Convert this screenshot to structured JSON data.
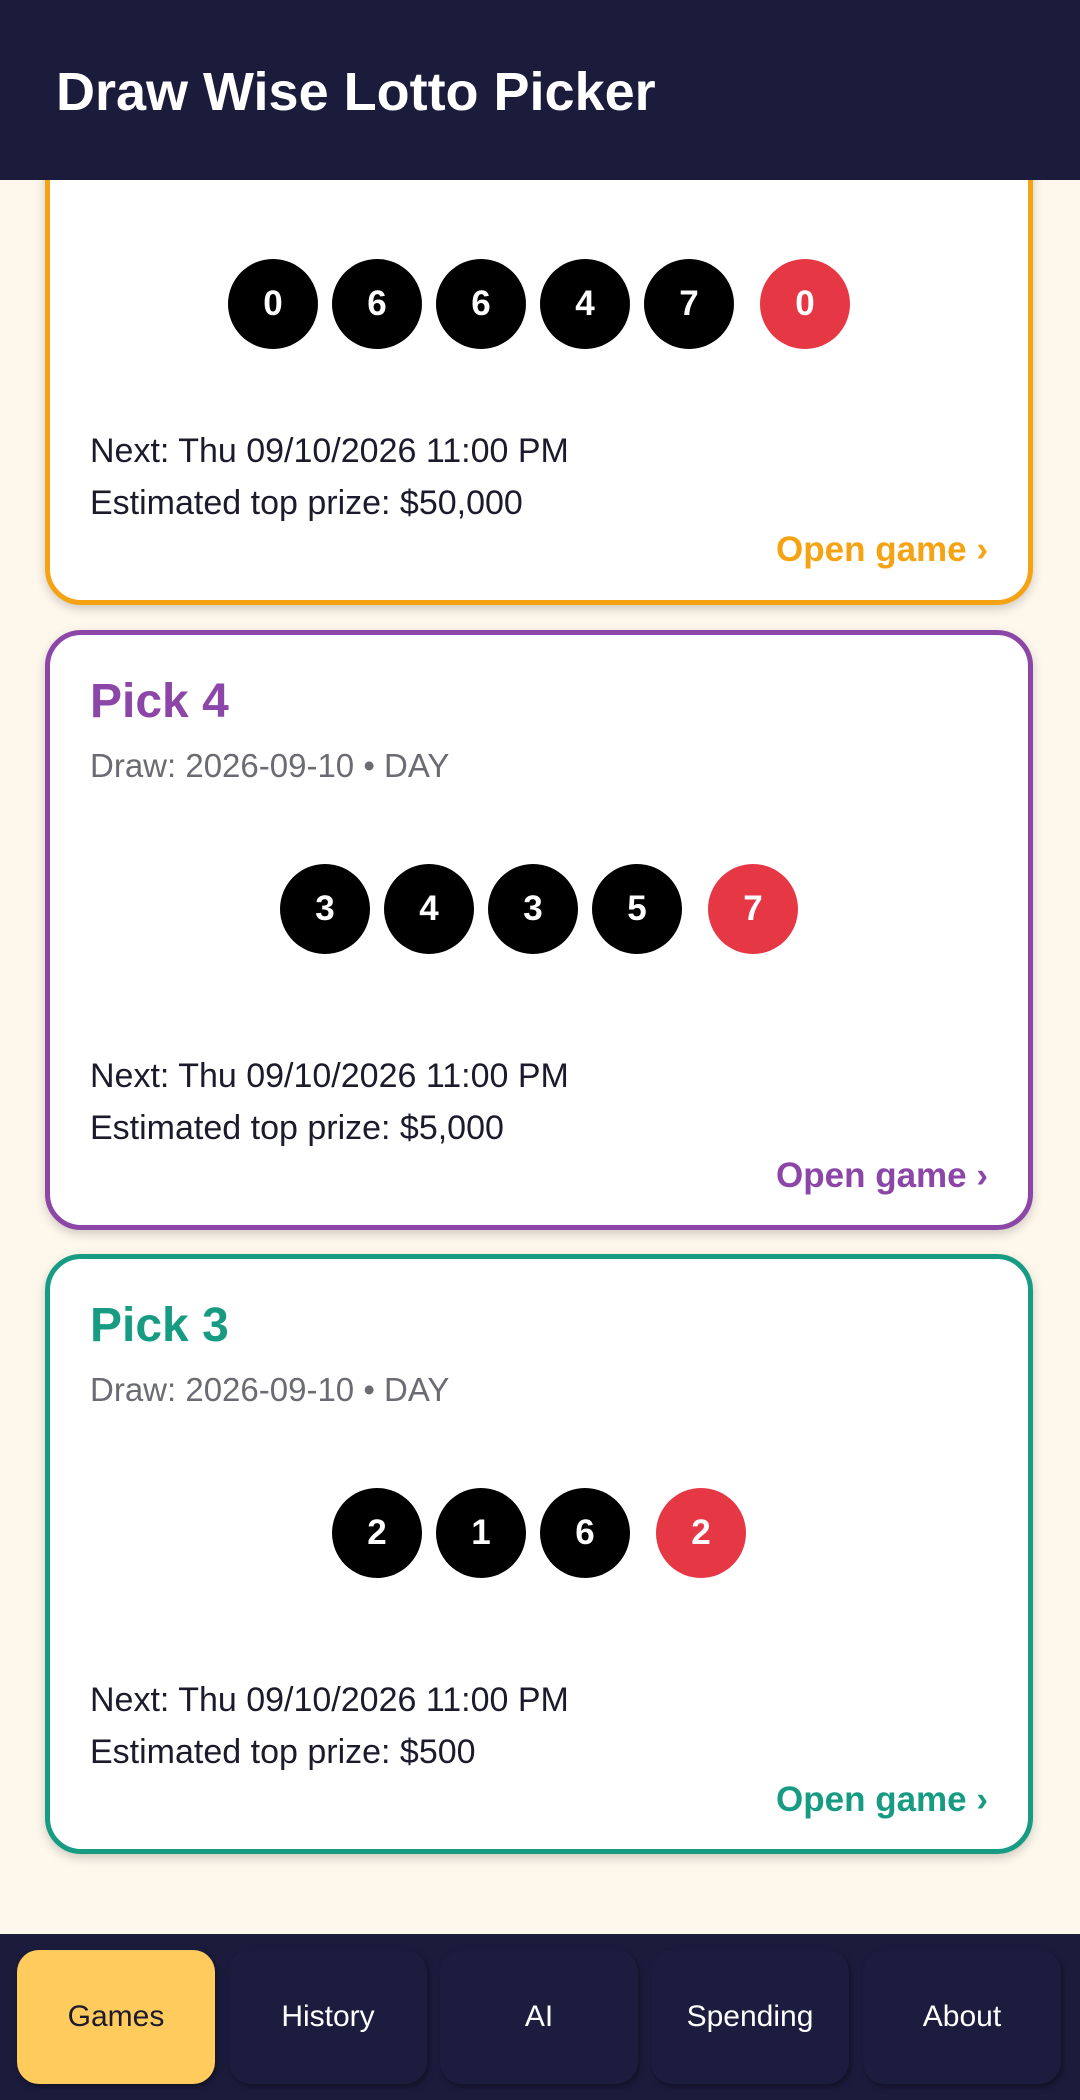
{
  "app": {
    "title": "Draw Wise Lotto Picker"
  },
  "games": [
    {
      "name": "",
      "draw_info": "",
      "numbers": [
        "0",
        "6",
        "6",
        "4",
        "7"
      ],
      "bonus": "0",
      "next": "Next: Thu 09/10/2026 11:00 PM",
      "prize": "Estimated top prize: $50,000",
      "open_label": "Open game ›",
      "accent": "#f6a313"
    },
    {
      "name": "Pick 4",
      "draw_info": "Draw: 2026-09-10 • DAY",
      "numbers": [
        "3",
        "4",
        "3",
        "5"
      ],
      "bonus": "7",
      "next": "Next: Thu 09/10/2026 11:00 PM",
      "prize": "Estimated top prize: $5,000",
      "open_label": "Open game ›",
      "accent": "#8b46a8"
    },
    {
      "name": "Pick 3",
      "draw_info": "Draw: 2026-09-10 • DAY",
      "numbers": [
        "2",
        "1",
        "6"
      ],
      "bonus": "2",
      "next": "Next: Thu 09/10/2026 11:00 PM",
      "prize": "Estimated top prize: $500",
      "open_label": "Open game ›",
      "accent": "#179c83"
    }
  ],
  "colors": {
    "number_ball": "#000000",
    "bonus_ball": "#e63745",
    "header_bg": "#1b1b3c",
    "page_bg": "#fdf7ec",
    "nav_active": "#ffcb5c"
  },
  "nav": {
    "items": [
      {
        "label": "Games",
        "active": true
      },
      {
        "label": "History",
        "active": false
      },
      {
        "label": "AI",
        "active": false
      },
      {
        "label": "Spending",
        "active": false
      },
      {
        "label": "About",
        "active": false
      }
    ]
  }
}
